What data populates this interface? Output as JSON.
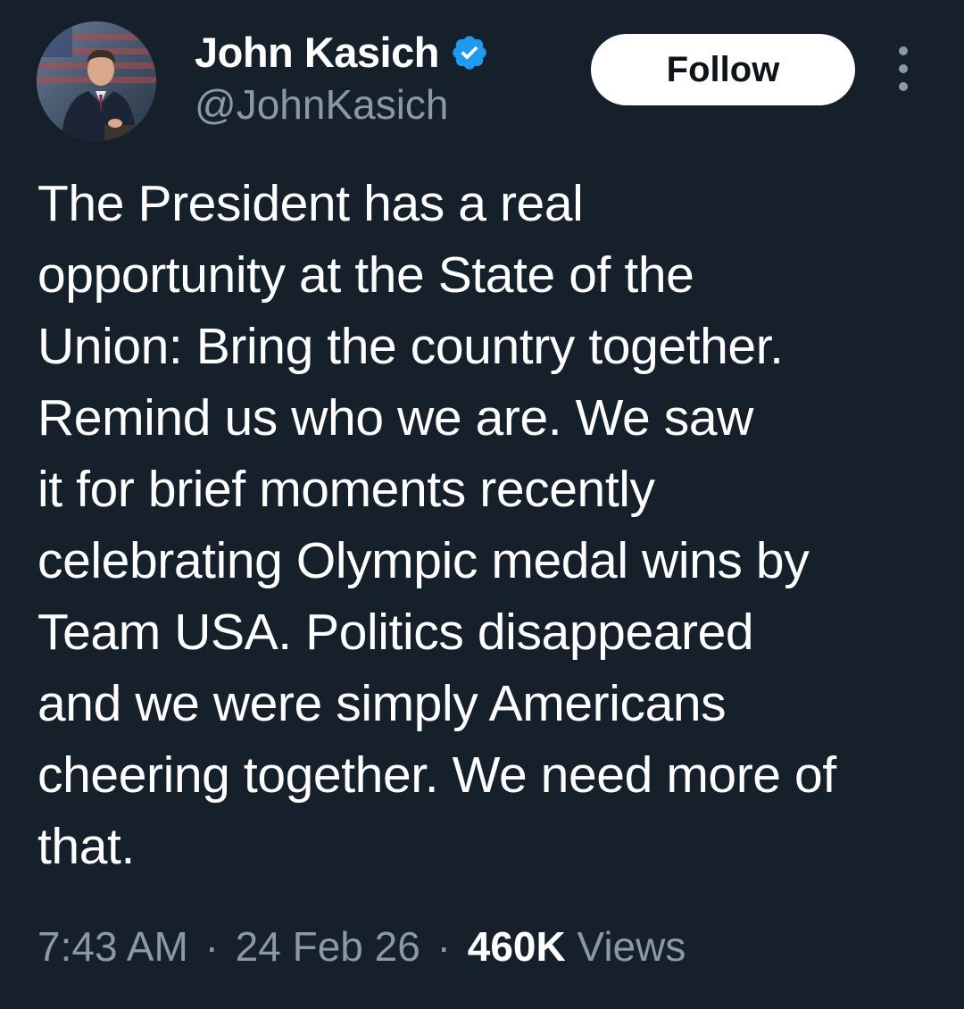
{
  "author": {
    "display_name": "John Kasich",
    "handle": "@JohnKasich",
    "verified_icon": "verified-badge-icon",
    "avatar_icon": "profile-photo"
  },
  "actions": {
    "follow_label": "Follow",
    "more_icon": "more-vertical-icon"
  },
  "tweet": {
    "lines": [
      "The President has a real",
      "opportunity at the State of the",
      "Union: Bring the country together.",
      "Remind us who we are. We saw",
      "it for brief moments recently",
      "celebrating Olympic medal wins by",
      "Team USA. Politics disappeared",
      "and we were simply Americans",
      "cheering together. We need more of",
      "that."
    ]
  },
  "meta": {
    "time": "7:43 AM",
    "separator": "·",
    "date": "24 Feb 26",
    "views_count": "460K",
    "views_label": "Views"
  },
  "colors": {
    "background": "#15202b",
    "text_primary": "#ffffff",
    "text_secondary": "#8b98a5",
    "verified_blue": "#1d9bf0",
    "button_bg": "#ffffff",
    "button_text": "#0f1419"
  }
}
